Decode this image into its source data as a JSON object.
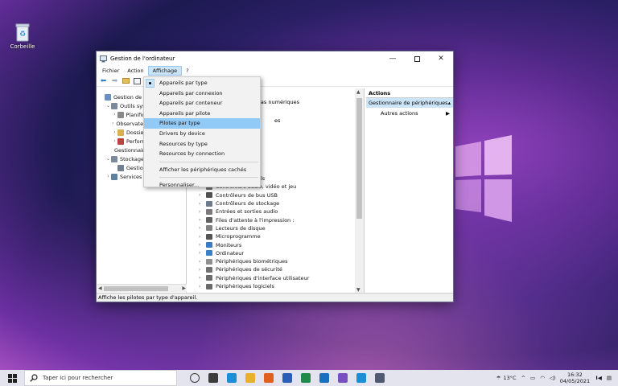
{
  "desktop": {
    "recycle_bin_label": "Corbeille"
  },
  "window": {
    "title": "Gestion de l'ordinateur",
    "menu": [
      "Fichier",
      "Action",
      "Affichage",
      "?"
    ],
    "active_menu": "Affichage"
  },
  "tree": [
    {
      "label": "Gestion de l'ordinateur",
      "indent": 0,
      "exp": "",
      "color": "#6b8fbf"
    },
    {
      "label": "Outils système",
      "indent": 1,
      "exp": "⌄",
      "color": "#7a8a9a"
    },
    {
      "label": "Planificateur de tâches",
      "indent": 2,
      "exp": "›",
      "color": "#8a8a8a"
    },
    {
      "label": "Observateur d'événements",
      "indent": 2,
      "exp": "›",
      "color": "#a07040"
    },
    {
      "label": "Dossiers partagés",
      "indent": 2,
      "exp": "›",
      "color": "#d8b050"
    },
    {
      "label": "Performance",
      "indent": 2,
      "exp": "›",
      "color": "#c04040"
    },
    {
      "label": "Gestionnaire de périphériques",
      "indent": 2,
      "exp": "",
      "color": "#607080"
    },
    {
      "label": "Stockage",
      "indent": 1,
      "exp": "⌄",
      "color": "#7a8a9a"
    },
    {
      "label": "Gestion des disques",
      "indent": 2,
      "exp": "",
      "color": "#708090"
    },
    {
      "label": "Services et applications",
      "indent": 1,
      "exp": "›",
      "color": "#6080a0"
    }
  ],
  "devices_partial": [
    {
      "label": "dias numériques"
    },
    {
      "label": "es"
    }
  ],
  "devices": [
    {
      "label": "els",
      "color": "#888"
    },
    {
      "label": "Contrôleurs audio, vidéo et jeu",
      "color": "#707070"
    },
    {
      "label": "Contrôleurs de bus USB",
      "color": "#505050"
    },
    {
      "label": "Contrôleurs de stockage",
      "color": "#6a7a8a"
    },
    {
      "label": "Entrées et sorties audio",
      "color": "#7a7a7a"
    },
    {
      "label": "Files d'attente à l'impression :",
      "color": "#606060"
    },
    {
      "label": "Lecteurs de disque",
      "color": "#808080"
    },
    {
      "label": "Microprogramme",
      "color": "#555"
    },
    {
      "label": "Moniteurs",
      "color": "#3a7ac0"
    },
    {
      "label": "Ordinateur",
      "color": "#3a80c8"
    },
    {
      "label": "Périphériques biométriques",
      "color": "#909090"
    },
    {
      "label": "Périphériques de sécurité",
      "color": "#707070"
    },
    {
      "label": "Périphériques d'interface utilisateur",
      "color": "#6a6a6a"
    },
    {
      "label": "Périphériques logiciels",
      "color": "#6a6a6a"
    }
  ],
  "actions": {
    "header": "Actions",
    "section": "Gestionnaire de périphériques",
    "item": "Autres actions"
  },
  "status": "Affiche les pilotes par type d'appareil.",
  "dropdown": [
    {
      "label": "Appareils par type",
      "checked": true
    },
    {
      "label": "Appareils par connexion"
    },
    {
      "label": "Appareils par conteneur"
    },
    {
      "label": "Appareils par pilote"
    },
    {
      "label": "Pilotes par type",
      "hover": true
    },
    {
      "label": "Drivers by device"
    },
    {
      "label": "Resources by type"
    },
    {
      "label": "Resources by connection",
      "sep_after": true
    },
    {
      "label": "Afficher les périphériques cachés",
      "sep_after": true
    },
    {
      "label": "Personnaliser..."
    }
  ],
  "taskbar": {
    "search_placeholder": "Taper ici pour rechercher",
    "weather": "13°C",
    "time": "16:32",
    "date": "04/05/2021",
    "apps": [
      "#3b3b3b",
      "#3b3b3b",
      "#1a8fd8",
      "#e8b030",
      "#e06020",
      "#2b5fb5",
      "#1f8a4a",
      "#1a6fc0",
      "#7a50c0",
      "#1a8fd8",
      "#505a70"
    ]
  }
}
